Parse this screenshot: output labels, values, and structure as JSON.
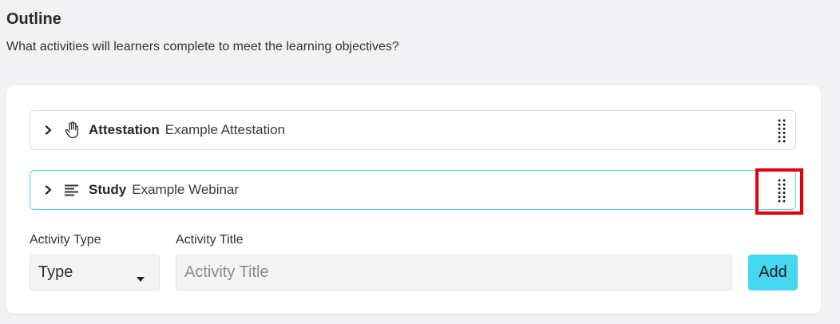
{
  "section": {
    "title": "Outline",
    "subtitle": "What activities will learners complete to meet the learning objectives?"
  },
  "activities": [
    {
      "kind": "Attestation",
      "name": "Example Attestation",
      "icon": "hand-icon"
    },
    {
      "kind": "Study",
      "name": "Example Webinar",
      "icon": "text-lines-icon"
    }
  ],
  "form": {
    "activity_type_label": "Activity Type",
    "activity_type_value": "Type",
    "activity_title_label": "Activity Title",
    "activity_title_placeholder": "Activity Title",
    "add_label": "Add"
  },
  "colors": {
    "accent": "#45d6f0",
    "selected_border": "#52d4ea",
    "highlight": "#e2000f"
  }
}
